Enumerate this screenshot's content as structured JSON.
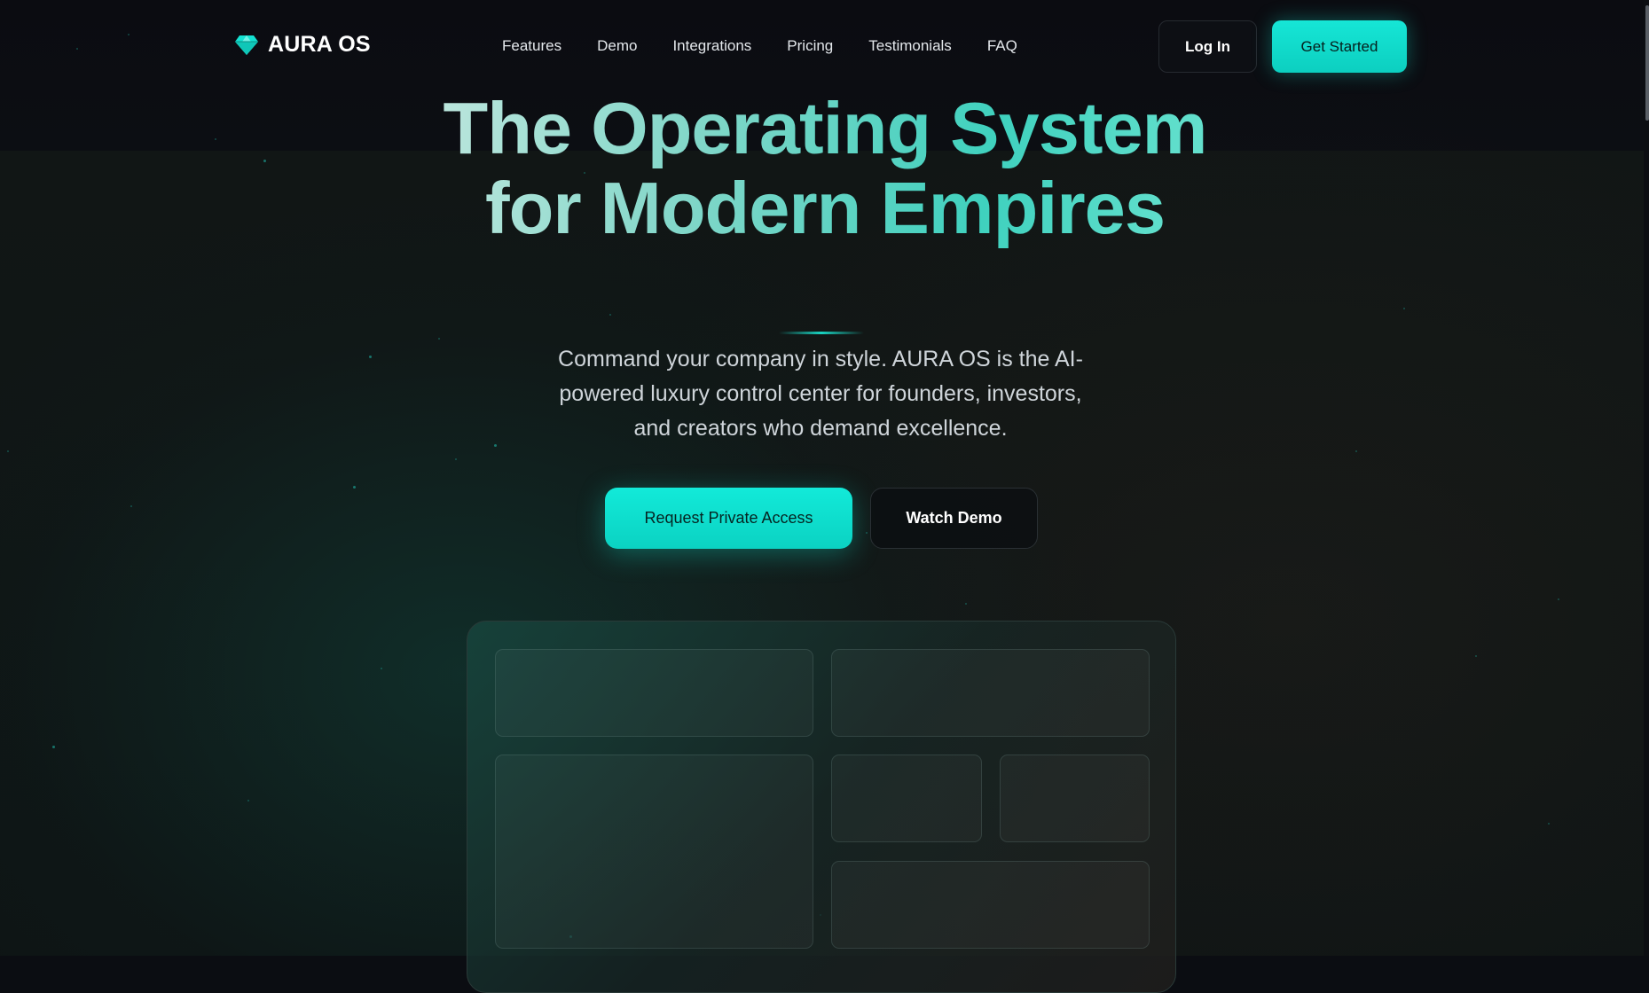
{
  "brand": {
    "name": "AURA OS",
    "icon": "diamond-icon",
    "accent": "#14e2d2"
  },
  "nav": {
    "links": [
      "Features",
      "Demo",
      "Integrations",
      "Pricing",
      "Testimonials",
      "FAQ"
    ],
    "login_label": "Log In",
    "cta_label": "Get Started"
  },
  "hero": {
    "title": "The Operating System for Modern Empires",
    "subtitle": "Command your company in style. AURA OS is the AI-powered luxury control center for founders, investors, and creators who demand excellence.",
    "primary_cta": "Request Private Access",
    "secondary_cta": "Watch Demo"
  },
  "colors": {
    "background": "#0b0d12",
    "accent": "#14e2d2",
    "text": "#e8ecef"
  }
}
